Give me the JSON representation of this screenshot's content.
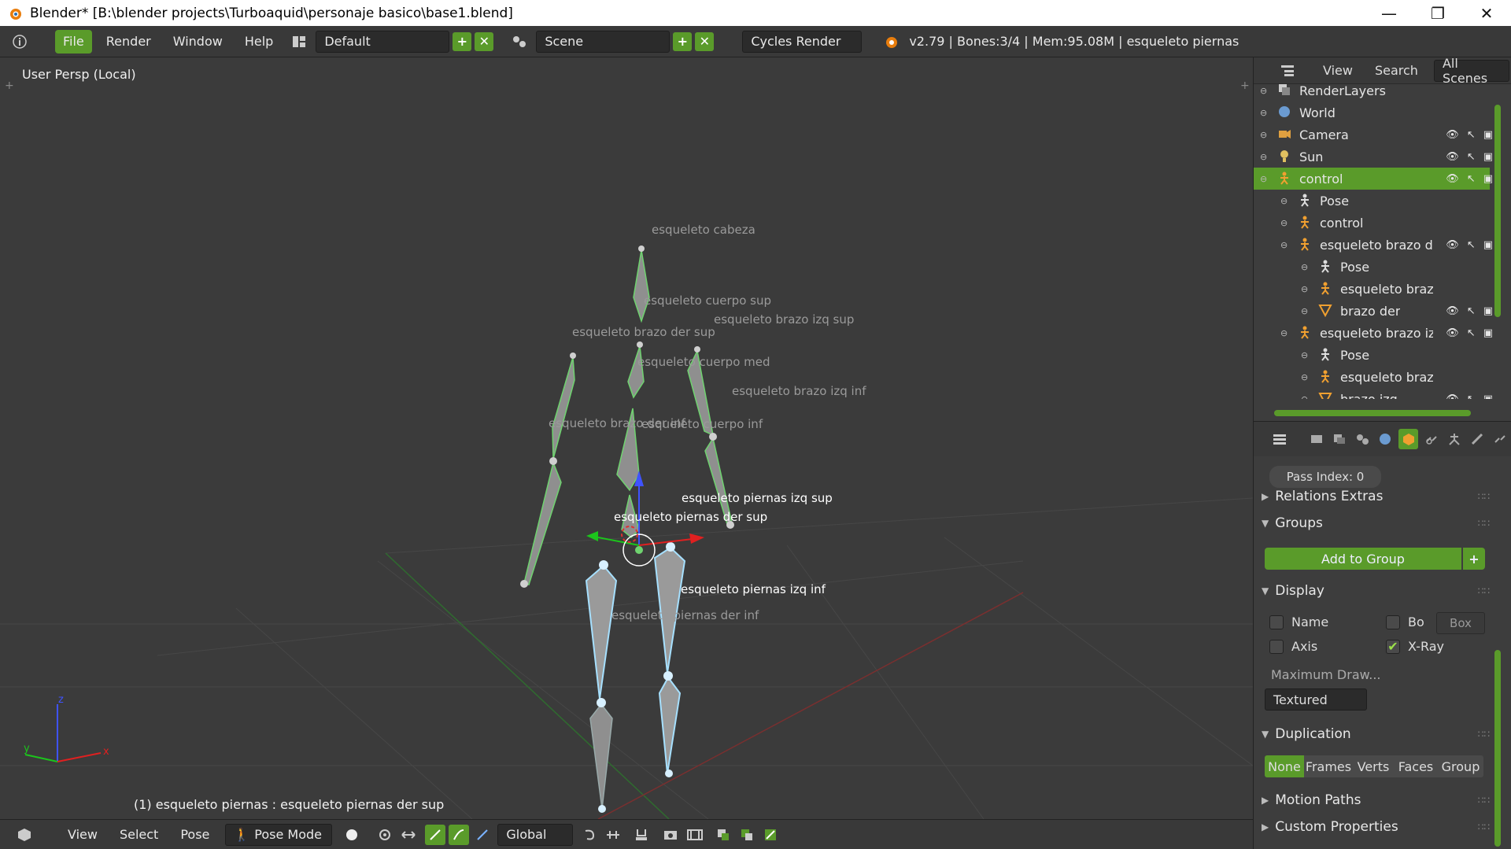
{
  "window": {
    "title": "Blender* [B:\\blender projects\\Turboaquid\\personaje basico\\base1.blend]",
    "controls": [
      "—",
      "❐",
      "✕"
    ]
  },
  "topbar": {
    "menus": [
      "File",
      "Render",
      "Window",
      "Help"
    ],
    "layout": "Default",
    "scene": "Scene",
    "engine": "Cycles Render",
    "stats": "v2.79 | Bones:3/4 | Mem:95.08M | esqueleto piernas"
  },
  "viewport": {
    "view_label": "User Persp (Local)",
    "status": "(1) esqueleto piernas : esqueleto piernas der sup",
    "bone_labels": [
      {
        "text": "esqueleto cabeza",
        "selected": false
      },
      {
        "text": "esqueleto cuerpo sup",
        "selected": false
      },
      {
        "text": "esqueleto brazo izq sup",
        "selected": false
      },
      {
        "text": "esqueleto brazo der sup",
        "selected": false
      },
      {
        "text": "esqueleto cuerpo med",
        "selected": false
      },
      {
        "text": "esqueleto brazo izq inf",
        "selected": false
      },
      {
        "text": "esqueleto brazo der inf",
        "selected": false
      },
      {
        "text": "esqueleto cuerpo inf",
        "selected": false
      },
      {
        "text": "esqueleto piernas izq sup",
        "selected": true
      },
      {
        "text": "esqueleto piernas der sup",
        "selected": true
      },
      {
        "text": "esqueleto piernas izq inf",
        "selected": true
      },
      {
        "text": "esqueleto piernas der inf",
        "selected": false
      }
    ],
    "axis": {
      "z": "z",
      "y": "y",
      "x": "x"
    }
  },
  "bottombar": {
    "menus": [
      "View",
      "Select",
      "Pose"
    ],
    "mode": "Pose Mode",
    "orientation": "Global"
  },
  "outliner": {
    "tabs": [
      "View",
      "Search",
      "All Scenes"
    ],
    "rows": [
      {
        "label": "RenderLayers",
        "indent": 0,
        "active": false,
        "vis": false
      },
      {
        "label": "World",
        "indent": 0,
        "active": false,
        "vis": false
      },
      {
        "label": "Camera",
        "indent": 0,
        "active": false,
        "vis": true
      },
      {
        "label": "Sun",
        "indent": 0,
        "active": false,
        "vis": true
      },
      {
        "label": "control",
        "indent": 0,
        "active": true,
        "vis": true
      },
      {
        "label": "Pose",
        "indent": 1,
        "active": false,
        "vis": false
      },
      {
        "label": "control",
        "indent": 1,
        "active": false,
        "vis": false
      },
      {
        "label": "esqueleto brazo de",
        "indent": 1,
        "active": false,
        "vis": true
      },
      {
        "label": "Pose",
        "indent": 2,
        "active": false,
        "vis": false
      },
      {
        "label": "esqueleto brazi",
        "indent": 2,
        "active": false,
        "vis": false
      },
      {
        "label": "brazo der",
        "indent": 2,
        "active": false,
        "vis": true
      },
      {
        "label": "esqueleto brazo izc",
        "indent": 1,
        "active": false,
        "vis": true
      },
      {
        "label": "Pose",
        "indent": 2,
        "active": false,
        "vis": false
      },
      {
        "label": "esqueleto brazi",
        "indent": 2,
        "active": false,
        "vis": false
      },
      {
        "label": "brazo izq",
        "indent": 2,
        "active": false,
        "vis": true
      }
    ]
  },
  "properties": {
    "pass_index": "Pass Index: 0",
    "relations_extras": "Relations Extras",
    "groups": "Groups",
    "add_to_group": "Add to Group",
    "display": "Display",
    "name_label": "Name",
    "bo_label": "Bo",
    "box_value": "Box",
    "axis_label": "Axis",
    "xray_label": "X-Ray",
    "max_draw_label": "Maximum Draw...",
    "max_draw_value": "Textured",
    "duplication": "Duplication",
    "dup_options": [
      "None",
      "Frames",
      "Verts",
      "Faces",
      "Group"
    ],
    "motion_paths": "Motion Paths",
    "custom_properties": "Custom Properties"
  },
  "colors": {
    "accent": "#5a9b2a",
    "selected_bone": "#a6e0ff",
    "unselected_bone": "#8f8f8f"
  }
}
